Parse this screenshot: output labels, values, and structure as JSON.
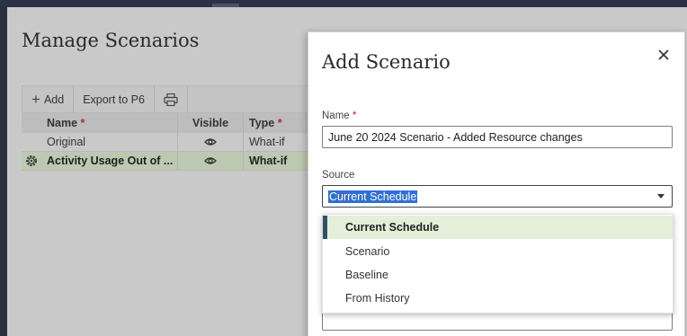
{
  "background_page": {
    "title": "Manage Scenarios",
    "toolbar": {
      "add_label": "Add",
      "export_label": "Export to P6"
    },
    "grid": {
      "columns": {
        "name": "Name",
        "visible": "Visible",
        "type": "Type"
      },
      "required_marker": "*",
      "rows": [
        {
          "name": "Original",
          "type": "What-if",
          "selected": false
        },
        {
          "name": "Activity Usage Out of ...",
          "type": "What-if",
          "selected": true
        }
      ]
    }
  },
  "dialog": {
    "title": "Add Scenario",
    "name_label": "Name",
    "required_marker": "*",
    "name_value": "June 20 2024 Scenario - Added Resource changes",
    "source_label": "Source",
    "source_value": "Current Schedule",
    "source_options": [
      "Current Schedule",
      "Scenario",
      "Baseline",
      "From History"
    ],
    "selected_option": "Current Schedule"
  },
  "colors": {
    "selected_row_bg": "#bcc9b1",
    "selected_option_bg": "#e3efd9",
    "selected_option_marker": "#2d5363",
    "text_selection": "#2f6fd6",
    "required": "#b02a2a"
  }
}
